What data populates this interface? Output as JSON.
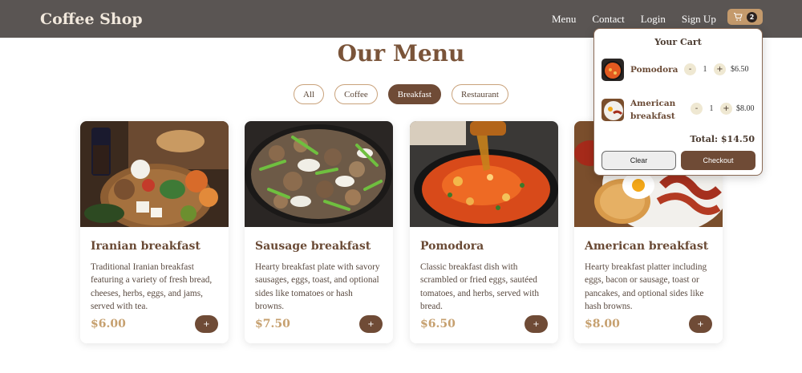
{
  "brand": "Coffee Shop",
  "nav": {
    "links": [
      "Menu",
      "Contact",
      "Login",
      "Sign Up"
    ],
    "cart_count": "2"
  },
  "page_title": "Our Menu",
  "filters": [
    {
      "label": "All",
      "active": false
    },
    {
      "label": "Coffee",
      "active": false
    },
    {
      "label": "Breakfast",
      "active": true
    },
    {
      "label": "Restaurant",
      "active": false
    }
  ],
  "cards": [
    {
      "title": "Iranian breakfast",
      "description": "Traditional Iranian breakfast featuring a variety of fresh bread, cheeses, herbs, eggs, and jams, served with tea.",
      "price": "$6.00",
      "add_label": "+"
    },
    {
      "title": "Sausage breakfast",
      "description": "Hearty breakfast plate with savory sausages, eggs, toast, and optional sides like tomatoes or hash browns.",
      "price": "$7.50",
      "add_label": "+"
    },
    {
      "title": "Pomodora",
      "description": "Classic breakfast dish with scrambled or fried eggs, sautéed tomatoes, and herbs, served with bread.",
      "price": "$6.50",
      "add_label": "+"
    },
    {
      "title": "American breakfast",
      "description": "Hearty breakfast platter including eggs, bacon or sausage, toast or pancakes, and optional sides like hash browns.",
      "price": "$8.00",
      "add_label": "+"
    }
  ],
  "cart": {
    "title": "Your Cart",
    "items": [
      {
        "name": "Pomodora",
        "quantity": "1",
        "price": "$6.50",
        "minus": "-",
        "plus": "+"
      },
      {
        "name": "American breakfast",
        "quantity": "1",
        "price": "$8.00",
        "minus": "-",
        "plus": "+"
      }
    ],
    "total": "Total: $14.50",
    "clear_label": "Clear",
    "checkout_label": "Checkout"
  },
  "colors": {
    "navbar": "#5a5553",
    "accent": "#6f4b36",
    "price": "#c6a06f",
    "cart_button": "#c49a6c"
  }
}
